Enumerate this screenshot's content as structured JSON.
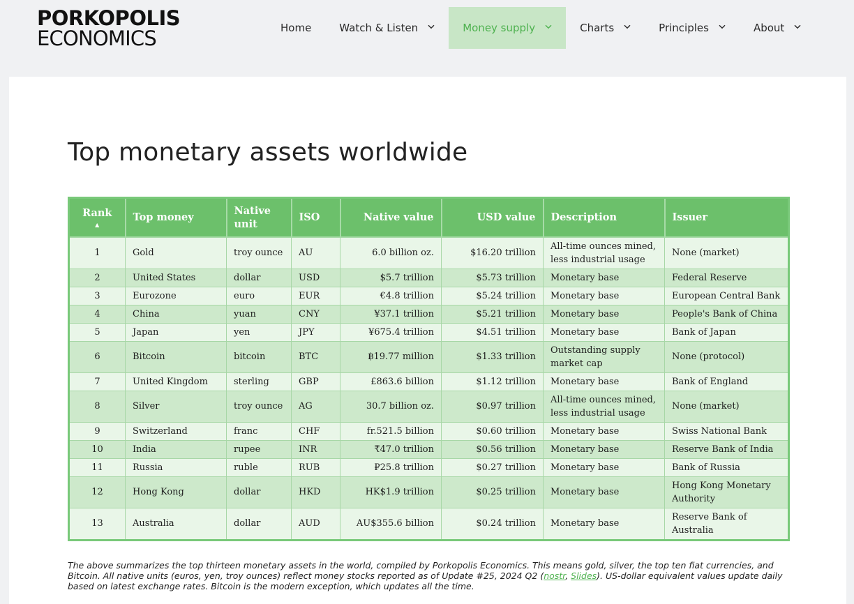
{
  "header": {
    "logo_line1": "PORKOPOLIS",
    "logo_line2": "ECONOMICS",
    "nav": [
      {
        "label": "Home",
        "has_dropdown": false,
        "active": false
      },
      {
        "label": "Watch & Listen",
        "has_dropdown": true,
        "active": false
      },
      {
        "label": "Money supply",
        "has_dropdown": true,
        "active": true
      },
      {
        "label": "Charts",
        "has_dropdown": true,
        "active": false
      },
      {
        "label": "Principles",
        "has_dropdown": true,
        "active": false
      },
      {
        "label": "About",
        "has_dropdown": true,
        "active": false
      }
    ]
  },
  "main": {
    "title": "Top monetary assets worldwide",
    "table": {
      "headers": [
        "Rank",
        "Top money",
        "Native unit",
        "ISO",
        "Native value",
        "USD value",
        "Description",
        "Issuer"
      ],
      "sort_indicator": "▲",
      "rows": [
        [
          "1",
          "Gold",
          "troy ounce",
          "AU",
          "6.0 billion oz.",
          "$16.20 trillion",
          "All-time ounces mined, less industrial usage",
          "None (market)"
        ],
        [
          "2",
          "United States",
          "dollar",
          "USD",
          "$5.7 trillion",
          "$5.73 trillion",
          "Monetary base",
          "Federal Reserve"
        ],
        [
          "3",
          "Eurozone",
          "euro",
          "EUR",
          "€4.8 trillion",
          "$5.24 trillion",
          "Monetary base",
          "European Central Bank"
        ],
        [
          "4",
          "China",
          "yuan",
          "CNY",
          "¥37.1 trillion",
          "$5.21 trillion",
          "Monetary base",
          "People's Bank of China"
        ],
        [
          "5",
          "Japan",
          "yen",
          "JPY",
          "¥675.4 trillion",
          "$4.51 trillion",
          "Monetary base",
          "Bank of Japan"
        ],
        [
          "6",
          "Bitcoin",
          "bitcoin",
          "BTC",
          "฿19.77 million",
          "$1.33 trillion",
          "Outstanding supply market cap",
          "None (protocol)"
        ],
        [
          "7",
          "United Kingdom",
          "sterling",
          "GBP",
          "£863.6 billion",
          "$1.12 trillion",
          "Monetary base",
          "Bank of England"
        ],
        [
          "8",
          "Silver",
          "troy ounce",
          "AG",
          "30.7 billion oz.",
          "$0.97 trillion",
          "All-time ounces mined, less industrial usage",
          "None (market)"
        ],
        [
          "9",
          "Switzerland",
          "franc",
          "CHF",
          "fr.521.5 billion",
          "$0.60 trillion",
          "Monetary base",
          "Swiss National Bank"
        ],
        [
          "10",
          "India",
          "rupee",
          "INR",
          "₹47.0 trillion",
          "$0.56 trillion",
          "Monetary base",
          "Reserve Bank of India"
        ],
        [
          "11",
          "Russia",
          "ruble",
          "RUB",
          "₽25.8 trillion",
          "$0.27 trillion",
          "Monetary base",
          "Bank of Russia"
        ],
        [
          "12",
          "Hong Kong",
          "dollar",
          "HKD",
          "HK$1.9 trillion",
          "$0.25 trillion",
          "Monetary base",
          "Hong Kong Monetary Authority"
        ],
        [
          "13",
          "Australia",
          "dollar",
          "AUD",
          "AU$355.6 billion",
          "$0.24 trillion",
          "Monetary base",
          "Reserve Bank of Australia"
        ]
      ]
    },
    "footnote": {
      "text_before": "The above summarizes the top thirteen monetary assets in the world, compiled by Porkopolis Economics. This means gold, silver, the top ten fiat currencies, and Bitcoin. All native units (euros, yen, troy ounces) reflect money stocks reported as of Update #25, 2024 Q2 (",
      "link1": "nostr",
      "separator": ", ",
      "link2": "Slides",
      "text_after": "). US-dollar equivalent values update daily based on latest exchange rates. Bitcoin is the modern exception, which updates all the time."
    }
  },
  "colors": {
    "accent": "#6cc06b",
    "nav_active_bg": "#c8e6c6",
    "nav_active_text": "#4fb250",
    "row_light": "#e9f6e8",
    "row_dark": "#cde9cb"
  }
}
